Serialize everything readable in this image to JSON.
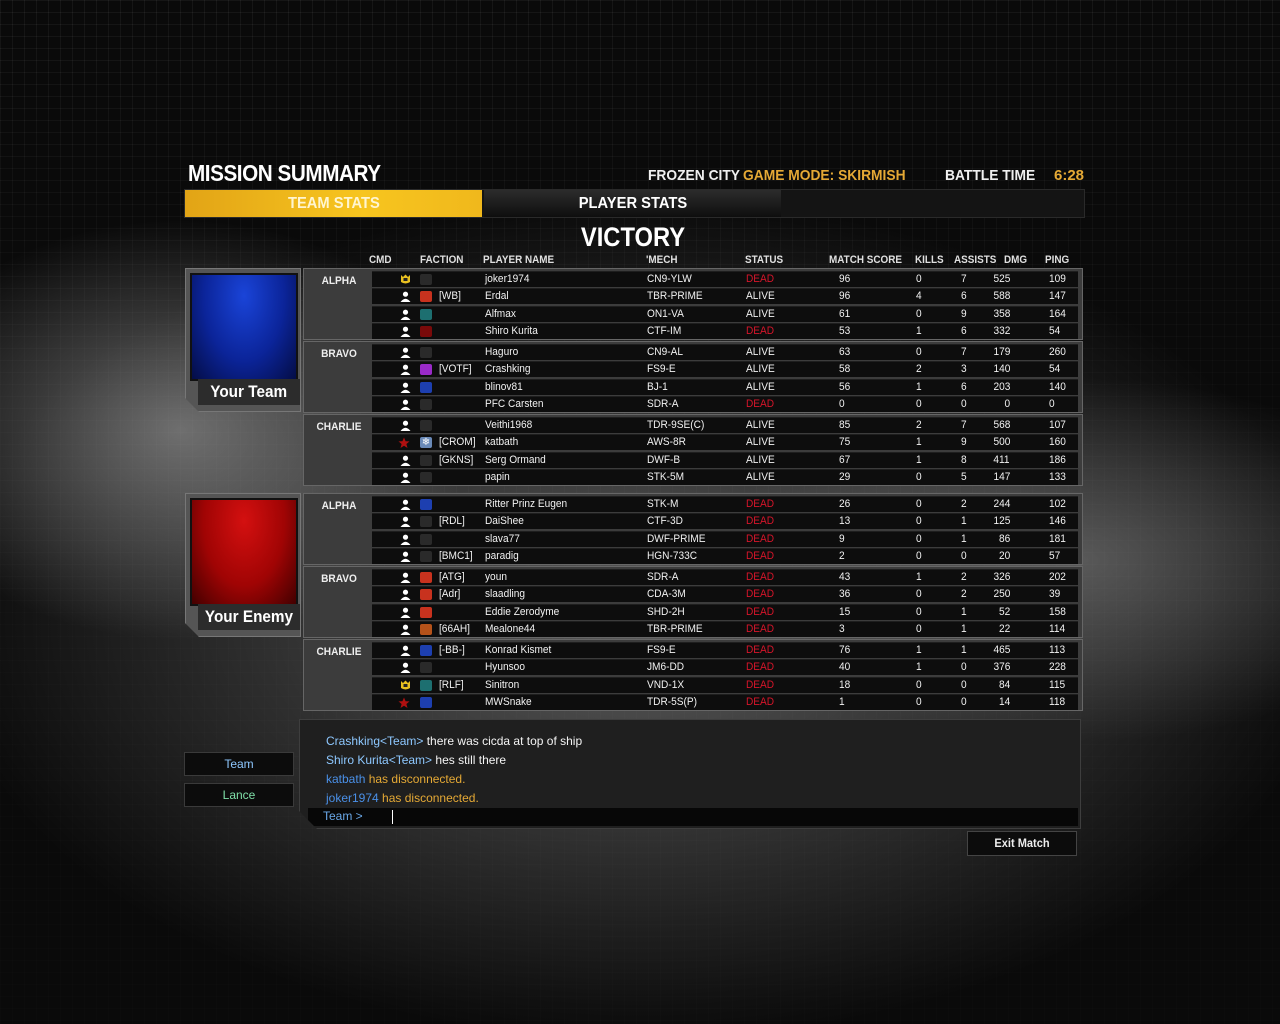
{
  "header": {
    "title": "MISSION SUMMARY",
    "map": "FROZEN CITY",
    "game_mode": "GAME MODE: SKIRMISH",
    "battle_time_label": "BATTLE TIME",
    "battle_time": "6:28"
  },
  "tabs": [
    {
      "label": "TEAM STATS",
      "active": true
    },
    {
      "label": "PLAYER STATS",
      "active": false
    }
  ],
  "result": "VICTORY",
  "columns": {
    "cmd": "CMD",
    "faction": "FACTION",
    "player": "PLAYER NAME",
    "mech": "'MECH",
    "status": "STATUS",
    "score": "MATCH SCORE",
    "kills": "KILLS",
    "assists": "ASSISTS",
    "dmg": "DMG",
    "ping": "PING"
  },
  "colors": {
    "accent": "#f7c51f",
    "game_mode": "#e5a935",
    "dead": "#d8152a",
    "your_team": "#0b2499",
    "enemy_team": "#a00404",
    "chat_name": "#6aa8e8",
    "chat_system": "#e5a935",
    "lance_button": "#7fe0a8"
  },
  "teams": [
    {
      "label": "Your Team",
      "banner": "blue",
      "lances": [
        {
          "name": "ALPHA",
          "players": [
            {
              "cmd": "commander-icon",
              "faction": "black",
              "tag": "",
              "name": "joker1974",
              "mech": "CN9-YLW",
              "status": "DEAD",
              "score": "96",
              "kills": "0",
              "assists": "7",
              "dmg": "525",
              "ping": "109"
            },
            {
              "cmd": "pilot-icon",
              "faction": "red",
              "tag": "[WB]",
              "name": "Erdal",
              "mech": "TBR-PRIME",
              "status": "ALIVE",
              "score": "96",
              "kills": "4",
              "assists": "6",
              "dmg": "588",
              "ping": "147"
            },
            {
              "cmd": "pilot-icon",
              "faction": "teal",
              "tag": "",
              "name": "Alfmax",
              "mech": "ON1-VA",
              "status": "ALIVE",
              "score": "61",
              "kills": "0",
              "assists": "9",
              "dmg": "358",
              "ping": "164"
            },
            {
              "cmd": "pilot-icon",
              "faction": "darkred",
              "tag": "",
              "name": "Shiro Kurita",
              "mech": "CTF-IM",
              "status": "DEAD",
              "score": "53",
              "kills": "1",
              "assists": "6",
              "dmg": "332",
              "ping": "54"
            }
          ]
        },
        {
          "name": "BRAVO",
          "players": [
            {
              "cmd": "pilot-icon",
              "faction": "black",
              "tag": "",
              "name": "Haguro",
              "mech": "CN9-AL",
              "status": "ALIVE",
              "score": "63",
              "kills": "0",
              "assists": "7",
              "dmg": "179",
              "ping": "260"
            },
            {
              "cmd": "pilot-icon",
              "faction": "purple",
              "tag": "[VOTF]",
              "name": "Crashking",
              "mech": "FS9-E",
              "status": "ALIVE",
              "score": "58",
              "kills": "2",
              "assists": "3",
              "dmg": "140",
              "ping": "54"
            },
            {
              "cmd": "pilot-icon",
              "faction": "blue",
              "tag": "",
              "name": "blinov81",
              "mech": "BJ-1",
              "status": "ALIVE",
              "score": "56",
              "kills": "1",
              "assists": "6",
              "dmg": "203",
              "ping": "140"
            },
            {
              "cmd": "pilot-icon",
              "faction": "black",
              "tag": "",
              "name": "PFC Carsten",
              "mech": "SDR-A",
              "status": "DEAD",
              "score": "0",
              "kills": "0",
              "assists": "0",
              "dmg": "0",
              "ping": "0"
            }
          ]
        },
        {
          "name": "CHARLIE",
          "players": [
            {
              "cmd": "pilot-icon",
              "faction": "black",
              "tag": "",
              "name": "Veithi1968",
              "mech": "TDR-9SE(C)",
              "status": "ALIVE",
              "score": "85",
              "kills": "2",
              "assists": "7",
              "dmg": "568",
              "ping": "107"
            },
            {
              "cmd": "founder-icon",
              "faction": "snowflake",
              "tag": "[CROM]",
              "name": "katbath",
              "mech": "AWS-8R",
              "status": "ALIVE",
              "score": "75",
              "kills": "1",
              "assists": "9",
              "dmg": "500",
              "ping": "160"
            },
            {
              "cmd": "pilot-icon",
              "faction": "black",
              "tag": "[GKNS]",
              "name": "Serg Ormand",
              "mech": "DWF-B",
              "status": "ALIVE",
              "score": "67",
              "kills": "1",
              "assists": "8",
              "dmg": "411",
              "ping": "186"
            },
            {
              "cmd": "pilot-icon",
              "faction": "black",
              "tag": "",
              "name": "papin",
              "mech": "STK-5M",
              "status": "ALIVE",
              "score": "29",
              "kills": "0",
              "assists": "5",
              "dmg": "147",
              "ping": "133"
            }
          ]
        }
      ]
    },
    {
      "label": "Your Enemy",
      "banner": "red",
      "lances": [
        {
          "name": "ALPHA",
          "players": [
            {
              "cmd": "pilot-icon",
              "faction": "blue",
              "tag": "",
              "name": "Ritter Prinz Eugen",
              "mech": "STK-M",
              "status": "DEAD",
              "score": "26",
              "kills": "0",
              "assists": "2",
              "dmg": "244",
              "ping": "102"
            },
            {
              "cmd": "pilot-icon",
              "faction": "black",
              "tag": "[RDL]",
              "name": "DaiShee",
              "mech": "CTF-3D",
              "status": "DEAD",
              "score": "13",
              "kills": "0",
              "assists": "1",
              "dmg": "125",
              "ping": "146"
            },
            {
              "cmd": "pilot-icon",
              "faction": "black",
              "tag": "",
              "name": "slava77",
              "mech": "DWF-PRIME",
              "status": "DEAD",
              "score": "9",
              "kills": "0",
              "assists": "1",
              "dmg": "86",
              "ping": "181"
            },
            {
              "cmd": "pilot-icon",
              "faction": "black",
              "tag": "[BMC1]",
              "name": "paradig",
              "mech": "HGN-733C",
              "status": "DEAD",
              "score": "2",
              "kills": "0",
              "assists": "0",
              "dmg": "20",
              "ping": "57"
            }
          ]
        },
        {
          "name": "BRAVO",
          "players": [
            {
              "cmd": "pilot-icon",
              "faction": "red",
              "tag": "[ATG]",
              "name": "youn",
              "mech": "SDR-A",
              "status": "DEAD",
              "score": "43",
              "kills": "1",
              "assists": "2",
              "dmg": "326",
              "ping": "202"
            },
            {
              "cmd": "pilot-icon",
              "faction": "red",
              "tag": "[Adr]",
              "name": "slaadling",
              "mech": "CDA-3M",
              "status": "DEAD",
              "score": "36",
              "kills": "0",
              "assists": "2",
              "dmg": "250",
              "ping": "39"
            },
            {
              "cmd": "pilot-icon",
              "faction": "red",
              "tag": "",
              "name": "Eddie Zerodyme",
              "mech": "SHD-2H",
              "status": "DEAD",
              "score": "15",
              "kills": "0",
              "assists": "1",
              "dmg": "52",
              "ping": "158"
            },
            {
              "cmd": "pilot-icon",
              "faction": "orange",
              "tag": "[66AH]",
              "name": "Mealone44",
              "mech": "TBR-PRIME",
              "status": "DEAD",
              "score": "3",
              "kills": "0",
              "assists": "1",
              "dmg": "22",
              "ping": "114"
            }
          ]
        },
        {
          "name": "CHARLIE",
          "players": [
            {
              "cmd": "pilot-icon",
              "faction": "blue",
              "tag": "[-BB-]",
              "name": "Konrad Kismet",
              "mech": "FS9-E",
              "status": "DEAD",
              "score": "76",
              "kills": "1",
              "assists": "1",
              "dmg": "465",
              "ping": "113"
            },
            {
              "cmd": "pilot-icon",
              "faction": "black",
              "tag": "",
              "name": "Hyunsoo",
              "mech": "JM6-DD",
              "status": "DEAD",
              "score": "40",
              "kills": "1",
              "assists": "0",
              "dmg": "376",
              "ping": "228"
            },
            {
              "cmd": "commander-icon",
              "faction": "teal",
              "tag": "[RLF]",
              "name": "Sinitron",
              "mech": "VND-1X",
              "status": "DEAD",
              "score": "18",
              "kills": "0",
              "assists": "0",
              "dmg": "84",
              "ping": "115"
            },
            {
              "cmd": "founder-icon",
              "faction": "blue",
              "tag": "",
              "name": "MWSnake",
              "mech": "TDR-5S(P)",
              "status": "DEAD",
              "score": "1",
              "kills": "0",
              "assists": "0",
              "dmg": "14",
              "ping": "118"
            }
          ]
        }
      ]
    }
  ],
  "chat": {
    "channels": [
      {
        "label": "Team",
        "color": "#8ec8ff"
      },
      {
        "label": "Lance",
        "color": "#7fe0a8"
      }
    ],
    "messages": [
      {
        "sender": "Crashking<Team>",
        "text": " there was cicda at top of ship",
        "type": "team"
      },
      {
        "sender": "Shiro Kurita<Team>",
        "text": " hes still there",
        "type": "team"
      },
      {
        "sender": "katbath",
        "text": " has disconnected.",
        "type": "system"
      },
      {
        "sender": "joker1974",
        "text": " has disconnected.",
        "type": "system"
      }
    ],
    "input_prefix": "Team >",
    "input_value": ""
  },
  "exit_button": "Exit Match"
}
